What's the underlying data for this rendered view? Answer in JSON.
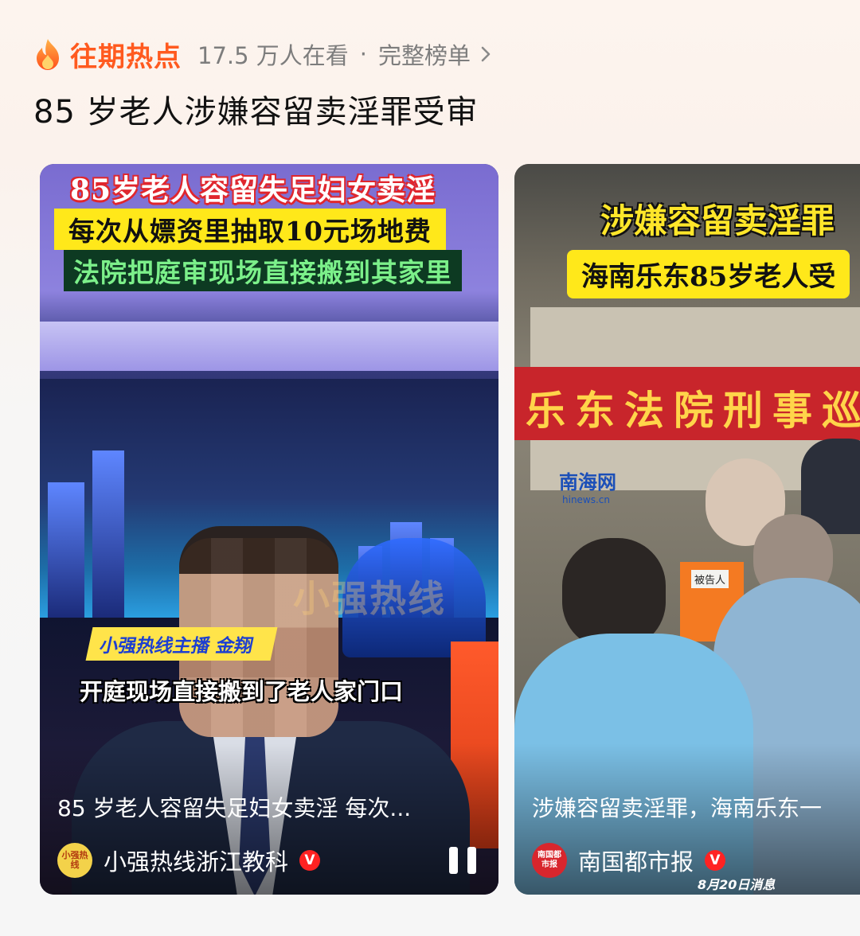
{
  "header": {
    "section_title": "往期热点",
    "viewers": "17.5 万人在看",
    "separator": "·",
    "full_list_label": "完整榜单"
  },
  "topic_title": "85 岁老人涉嫌容留卖淫罪受审",
  "cards": [
    {
      "overlay_red": "85岁老人容留失足妇女卖淫",
      "overlay_yellow": "每次从嫖资里抽取10元场地费",
      "overlay_green": "法院把庭审现场直接搬到其家里",
      "watermark": "小强热线",
      "anchor_tag": "小强热线主播 金翔",
      "subtitle": "开庭现场直接搬到了老人家门口",
      "caption": "85 岁老人容留失足妇女卖淫 每次...",
      "author": "小强热线浙江教科",
      "avatar_text": "小强热线",
      "verified": "V"
    },
    {
      "overlay_title": "涉嫌容留卖淫罪",
      "overlay_sub": "海南乐东85岁老人受",
      "banner": "乐东法院刑事巡",
      "logo": "南海网",
      "logo_url": "hinews.cn",
      "chair_label": "被告人",
      "caption": "涉嫌容留卖淫罪，海南乐东一",
      "author": "南国都市报",
      "avatar_text": "南国都市报",
      "verified": "V",
      "date_stamp": "8月20日消息"
    }
  ],
  "colors": {
    "accent": "#ff5a1f",
    "verified": "#ff2222",
    "card1_avatar_bg": "#f3d24a",
    "card2_avatar_bg": "#d8262d"
  }
}
